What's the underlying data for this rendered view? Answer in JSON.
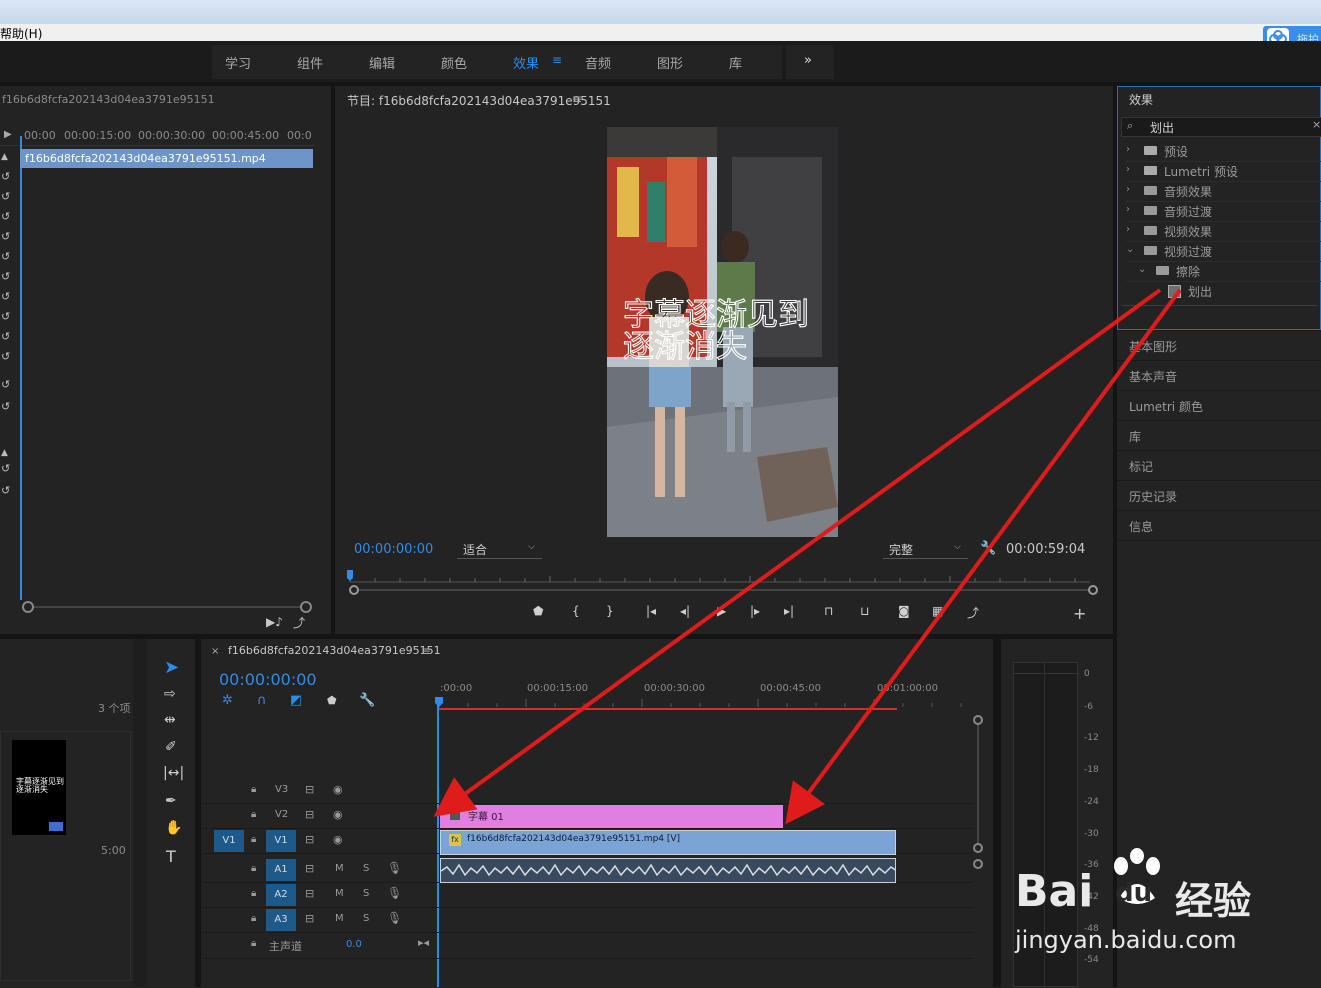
{
  "menu": {
    "help": "帮助(H)"
  },
  "workspace_tabs": [
    {
      "label": "学习",
      "active": false
    },
    {
      "label": "组件",
      "active": false
    },
    {
      "label": "编辑",
      "active": false
    },
    {
      "label": "颜色",
      "active": false
    },
    {
      "label": "效果",
      "active": true
    },
    {
      "label": "音频",
      "active": false
    },
    {
      "label": "图形",
      "active": false
    },
    {
      "label": "库",
      "active": false
    }
  ],
  "baidu_button": {
    "label": "拖拍"
  },
  "source_panel": {
    "title": "f16b6d8fcfa202143d04ea3791e95151",
    "ruler": [
      "00:00",
      "00:00:15:00",
      "00:00:30:00",
      "00:00:45:00",
      "00:0"
    ],
    "clip_name": "f16b6d8fcfa202143d04ea3791e95151.mp4"
  },
  "program_monitor": {
    "title": "节目: f16b6d8fcfa202143d04ea3791e95151",
    "timecode": "00:00:00:00",
    "fit": "适合",
    "quality": "完整",
    "duration": "00:00:59:04",
    "caption_line1": "字幕逐渐见到",
    "caption_line2": "逐渐消失"
  },
  "effects_panel": {
    "title": "效果",
    "search_value": "划出",
    "tree": [
      {
        "label": "预设"
      },
      {
        "label": "Lumetri 预设"
      },
      {
        "label": "音频效果"
      },
      {
        "label": "音频过渡"
      },
      {
        "label": "视频效果"
      },
      {
        "label": "视频过渡"
      }
    ],
    "subfolder": "擦除",
    "result": "划出"
  },
  "right_panels": [
    "基本图形",
    "基本声音",
    "Lumetri 颜色",
    "库",
    "标记",
    "历史记录",
    "信息"
  ],
  "project_panel": {
    "count": "3 个项",
    "duration": "5:00",
    "thumb_text": "字幕逐渐见到 逐渐消失"
  },
  "timeline": {
    "sequence_name": "f16b6d8fcfa202143d04ea3791e95151",
    "timecode": "00:00:00:00",
    "ruler": [
      ":00:00",
      "00:00:15:00",
      "00:00:30:00",
      "00:00:45:00",
      "00:01:00:00"
    ],
    "video_tracks": [
      "V3",
      "V2",
      "V1"
    ],
    "audio_tracks": [
      "A1",
      "A2",
      "A3"
    ],
    "source_patch": "V1",
    "master_label": "主声道",
    "master_value": "0.0",
    "title_clip": "字幕 01",
    "video_clip": "f16b6d8fcfa202143d04ea3791e95151.mp4 [V]",
    "m": "M",
    "s": "S"
  },
  "meter_scale": [
    "0",
    "-6",
    "-12",
    "-18",
    "-24",
    "-30",
    "-36",
    "-42",
    "-48",
    "-54"
  ],
  "watermark": {
    "brand": "Bai",
    "brand2": "du",
    "brand_cn": "经验",
    "url": "jingyan.baidu.com"
  },
  "colors": {
    "accent": "#2d8ceb",
    "title_clip": "#e07fe0",
    "video_clip": "#7ba3d6",
    "arrow": "#e01b1b"
  }
}
